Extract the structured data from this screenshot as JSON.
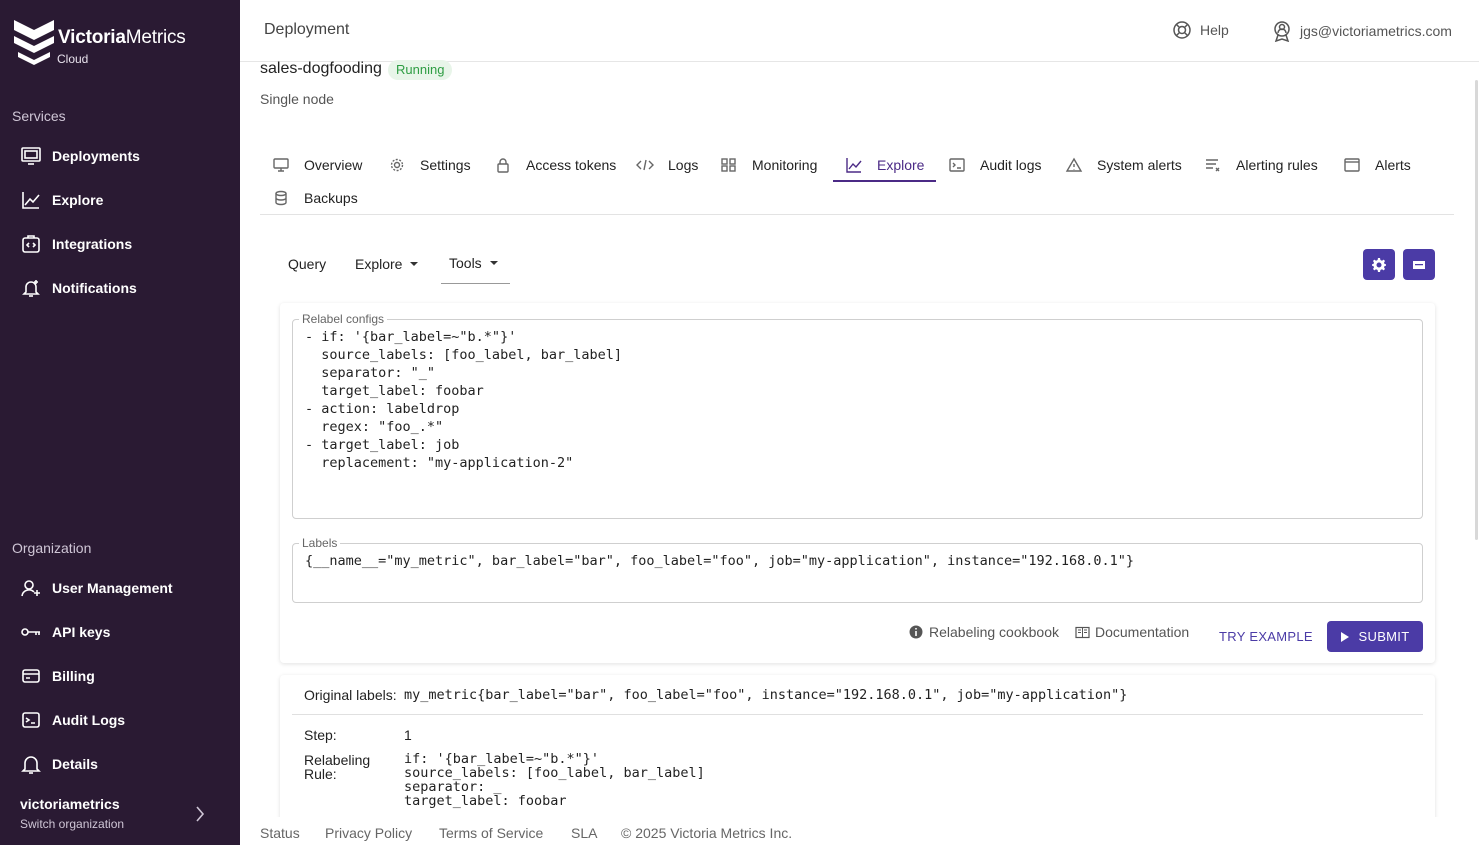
{
  "brand": {
    "name_bold": "Victoria",
    "name_rest": "Metrics",
    "sub": "Cloud"
  },
  "sidebar": {
    "services_title": "Services",
    "services": [
      {
        "label": "Deployments",
        "icon": "monitor-icon"
      },
      {
        "label": "Explore",
        "icon": "chart-line-icon"
      },
      {
        "label": "Integrations",
        "icon": "integration-icon"
      },
      {
        "label": "Notifications",
        "icon": "bell-icon"
      }
    ],
    "org_title": "Organization",
    "org_items": [
      {
        "label": "User Management",
        "icon": "user-add-icon"
      },
      {
        "label": "API keys",
        "icon": "key-icon"
      },
      {
        "label": "Billing",
        "icon": "card-icon"
      },
      {
        "label": "Audit Logs",
        "icon": "terminal-icon"
      },
      {
        "label": "Details",
        "icon": "bell-alert-icon"
      }
    ],
    "org_name": "victoriametrics",
    "org_switch": "Switch organization"
  },
  "header": {
    "title": "Deployment",
    "help": "Help",
    "user": "jgs@victoriametrics.com"
  },
  "deployment": {
    "name": "sales-dogfooding",
    "status": "Running",
    "type": "Single node"
  },
  "tabs": [
    {
      "label": "Overview",
      "icon": "monitor-icon"
    },
    {
      "label": "Settings",
      "icon": "gear-icon"
    },
    {
      "label": "Access tokens",
      "icon": "lock-icon"
    },
    {
      "label": "Logs",
      "icon": "code-icon"
    },
    {
      "label": "Monitoring",
      "icon": "grid-icon"
    },
    {
      "label": "Explore",
      "icon": "chart-line-icon",
      "active": true
    },
    {
      "label": "Audit logs",
      "icon": "terminal-icon"
    },
    {
      "label": "System alerts",
      "icon": "warning-icon"
    },
    {
      "label": "Alerting rules",
      "icon": "rules-icon"
    },
    {
      "label": "Alerts",
      "icon": "window-icon"
    },
    {
      "label": "Backups",
      "icon": "database-icon"
    }
  ],
  "subnav": {
    "query": "Query",
    "explore": "Explore",
    "tools": "Tools"
  },
  "relabel": {
    "legend": "Relabel configs",
    "config": "- if: '{bar_label=~\"b.*\"}'\n  source_labels: [foo_label, bar_label]\n  separator: \"_\"\n  target_label: foobar\n- action: labeldrop\n  regex: \"foo_.*\"\n- target_label: job\n  replacement: \"my-application-2\"",
    "labels_legend": "Labels",
    "labels": "{__name__=\"my_metric\", bar_label=\"bar\", foo_label=\"foo\", job=\"my-application\", instance=\"192.168.0.1\"}",
    "cookbook": "Relabeling cookbook",
    "docs": "Documentation",
    "try_example": "TRY EXAMPLE",
    "submit": "SUBMIT"
  },
  "result": {
    "original_label": "Original labels:",
    "original_value": "my_metric{bar_label=\"bar\", foo_label=\"foo\", instance=\"192.168.0.1\", job=\"my-application\"}",
    "step_label": "Step:",
    "step_value": "1",
    "rule_label": "Relabeling\nRule:",
    "rule_value": "if: '{bar_label=~\"b.*\"}'\nsource_labels: [foo_label, bar_label]\nseparator: _\ntarget_label: foobar"
  },
  "footer": {
    "status": "Status",
    "privacy": "Privacy Policy",
    "terms": "Terms of Service",
    "sla": "SLA",
    "copyright": "© 2025 Victoria Metrics Inc."
  }
}
